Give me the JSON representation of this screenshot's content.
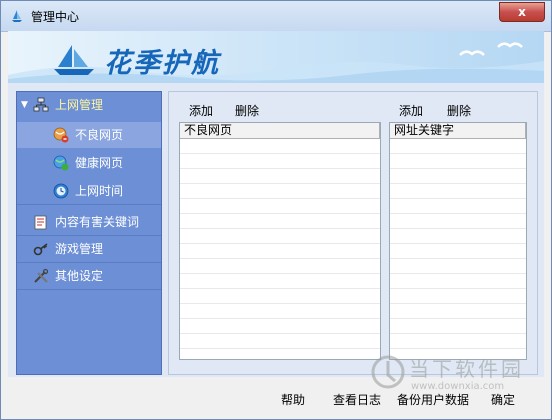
{
  "window": {
    "title": "管理中心",
    "close_label": "x"
  },
  "banner": {
    "title": "花季护航"
  },
  "sidebar": {
    "items": [
      {
        "label": "上网管理",
        "icon": "network-icon",
        "expanded": true
      },
      {
        "label": "不良网页",
        "icon": "bad-web-icon",
        "selected": true
      },
      {
        "label": "健康网页",
        "icon": "healthy-web-icon"
      },
      {
        "label": "上网时间",
        "icon": "clock-icon"
      },
      {
        "label": "内容有害关键词",
        "icon": "document-icon"
      },
      {
        "label": "游戏管理",
        "icon": "key-icon"
      },
      {
        "label": "其他设定",
        "icon": "tools-icon"
      }
    ]
  },
  "left_panel": {
    "add_label": "添加",
    "delete_label": "删除",
    "column_header": "不良网页"
  },
  "right_panel": {
    "add_label": "添加",
    "delete_label": "删除",
    "column_header": "网址关键字"
  },
  "footer": {
    "help": "帮助",
    "view_log": "查看日志",
    "backup": "备份用户数据",
    "ok": "确定"
  },
  "watermark": {
    "text": "当下软件园",
    "url": "www.downxia.com"
  },
  "colors": {
    "sidebar_bg": "#6c8fd6",
    "banner_title": "#1667b9",
    "close_button": "#c75050"
  }
}
